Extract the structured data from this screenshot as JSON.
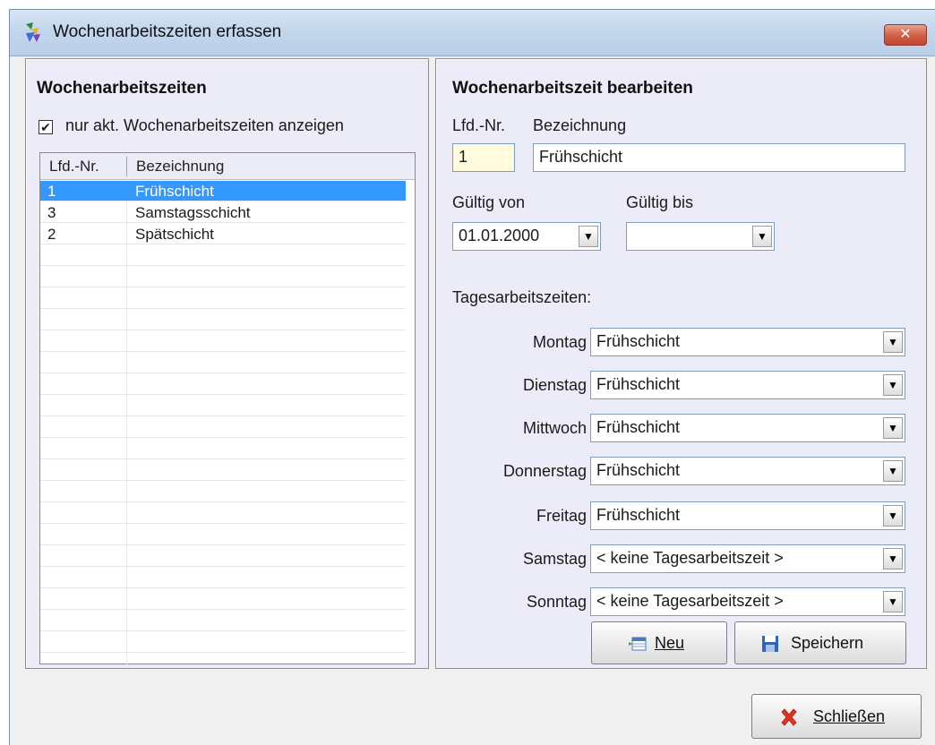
{
  "window": {
    "title": "Wochenarbeitszeiten erfassen",
    "close_label": "✕"
  },
  "left": {
    "title": "Wochenarbeitszeiten",
    "checkbox_label": "nur akt. Wochenarbeitszeiten anzeigen",
    "checkbox_checked": true,
    "columns": [
      "Lfd.-Nr.",
      "Bezeichnung"
    ],
    "rows": [
      {
        "nr": "1",
        "name": "Frühschicht",
        "selected": true
      },
      {
        "nr": "3",
        "name": "Samstagsschicht",
        "selected": false
      },
      {
        "nr": "2",
        "name": "Spätschicht",
        "selected": false
      }
    ]
  },
  "right": {
    "title": "Wochenarbeitszeit bearbeiten",
    "lfd_label": "Lfd.-Nr.",
    "lfd_value": "1",
    "bez_label": "Bezeichnung",
    "bez_value": "Frühschicht",
    "gueltig_von_label": "Gültig von",
    "gueltig_von_value": "01.01.2000",
    "gueltig_bis_label": "Gültig bis",
    "gueltig_bis_value": "",
    "tages_label": "Tagesarbeitszeiten:",
    "days": [
      {
        "label": "Montag",
        "value": "Frühschicht"
      },
      {
        "label": "Dienstag",
        "value": "Frühschicht"
      },
      {
        "label": "Mittwoch",
        "value": "Frühschicht"
      },
      {
        "label": "Donnerstag",
        "value": "Frühschicht"
      },
      {
        "label": "Freitag",
        "value": "Frühschicht"
      },
      {
        "label": "Samstag",
        "value": "< keine Tagesarbeitszeit >"
      },
      {
        "label": "Sonntag",
        "value": "< keine Tagesarbeitszeit >"
      }
    ],
    "neu_label": "Neu",
    "speichern_label": "Speichern"
  },
  "footer": {
    "schliessen_label": "Schließen"
  },
  "colors": {
    "selection": "#3399ff",
    "panel_bg": "#ececf8",
    "input_yellow": "#fffbdc"
  }
}
